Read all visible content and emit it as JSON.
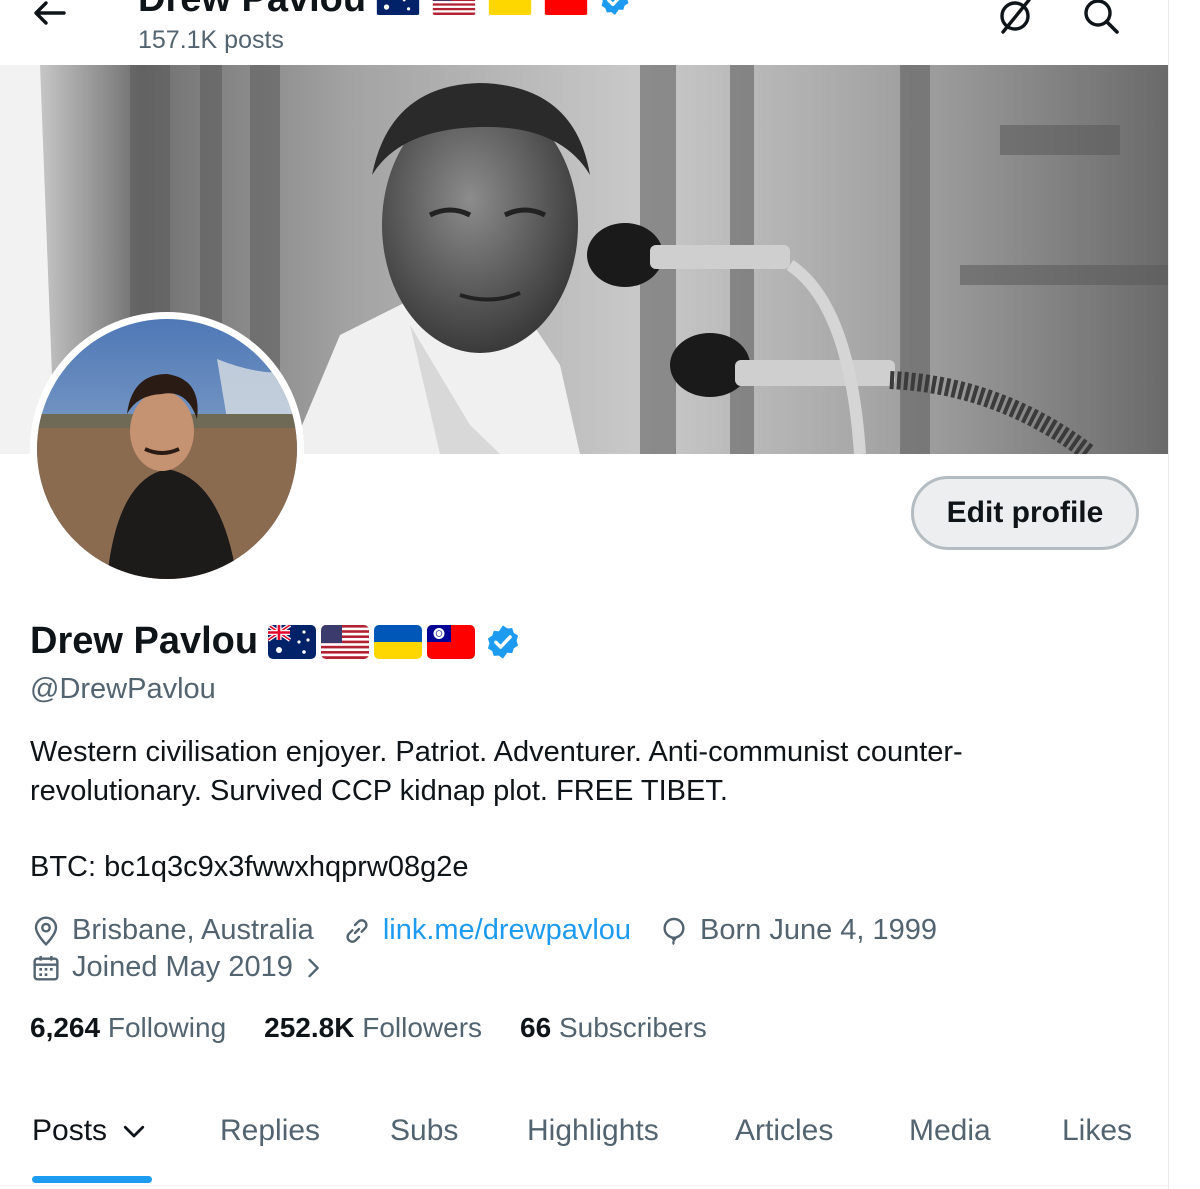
{
  "header": {
    "name": "Drew Pavlou",
    "posts_count": "157.1K posts"
  },
  "profile": {
    "display_name": "Drew Pavlou",
    "handle": "@DrewPavlou",
    "edit_button": "Edit profile",
    "bio_line_1": "Western civilisation enjoyer. Patriot. Adventurer. Anti-communist counter-",
    "bio_line_2": "revolutionary. Survived CCP kidnap plot. FREE TIBET.",
    "btc": "BTC: bc1q3c9x3fwwxhqprw08g2e",
    "location": "Brisbane, Australia",
    "website": "link.me/drewpavlou",
    "born": "Born June 4, 1999",
    "joined": "Joined May 2019"
  },
  "stats": {
    "following_count": "6,264",
    "following_label": "Following",
    "followers_count": "252.8K",
    "followers_label": "Followers",
    "subscribers_count": "66",
    "subscribers_label": "Subscribers"
  },
  "tabs": {
    "posts": "Posts",
    "replies": "Replies",
    "subs": "Subs",
    "highlights": "Highlights",
    "articles": "Articles",
    "media": "Media",
    "likes": "Likes"
  },
  "icons": {
    "back": "arrow-left-icon",
    "grok": "grok-icon",
    "search": "search-icon",
    "verified": "verified-badge-icon",
    "location": "location-pin-icon",
    "link": "link-icon",
    "birthday": "balloon-icon",
    "calendar": "calendar-icon",
    "chevron": "chevron-right-icon",
    "dropdown": "chevron-down-icon"
  },
  "colors": {
    "accent": "#1d9bf0",
    "text_primary": "#0f1419",
    "text_secondary": "#536471",
    "verified": "#1d9bf0"
  }
}
